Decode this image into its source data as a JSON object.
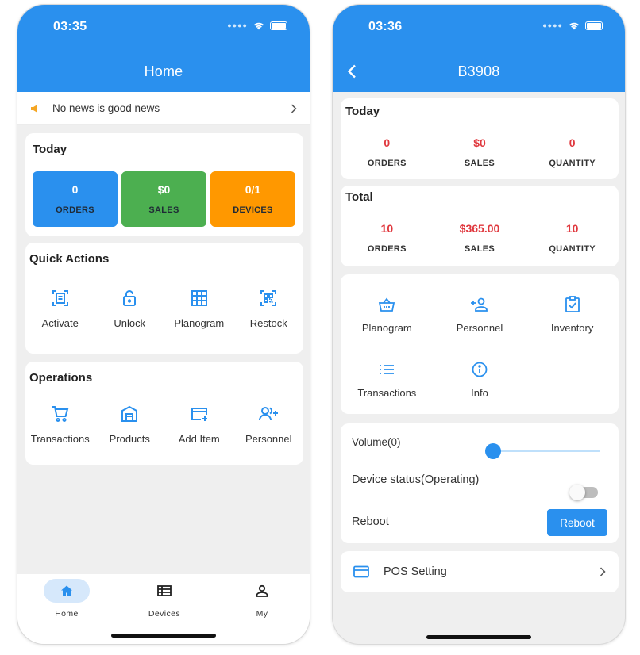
{
  "home": {
    "status_time": "03:35",
    "title": "Home",
    "news": "No news is good news",
    "today": {
      "title": "Today",
      "stats": [
        {
          "value": "0",
          "label": "ORDERS",
          "color": "#2a90ee"
        },
        {
          "value": "$0",
          "label": "SALES",
          "color": "#4caf50"
        },
        {
          "value": "0/1",
          "label": "DEVICES",
          "color": "#ff9800"
        }
      ]
    },
    "quick_actions": {
      "title": "Quick Actions",
      "items": [
        "Activate",
        "Unlock",
        "Planogram",
        "Restock"
      ]
    },
    "operations": {
      "title": "Operations",
      "items": [
        "Transactions",
        "Products",
        "Add Item",
        "Personnel"
      ]
    },
    "tabs": [
      "Home",
      "Devices",
      "My"
    ]
  },
  "device": {
    "status_time": "03:36",
    "title": "B3908",
    "today": {
      "title": "Today",
      "stats": [
        {
          "value": "0",
          "label": "ORDERS"
        },
        {
          "value": "$0",
          "label": "SALES"
        },
        {
          "value": "0",
          "label": "QUANTITY"
        }
      ]
    },
    "total": {
      "title": "Total",
      "stats": [
        {
          "value": "10",
          "label": "ORDERS"
        },
        {
          "value": "$365.00",
          "label": "SALES"
        },
        {
          "value": "10",
          "label": "QUANTITY"
        }
      ]
    },
    "actions_row1": [
      "Planogram",
      "Personnel",
      "Inventory"
    ],
    "actions_row2": [
      "Transactions",
      "Info"
    ],
    "volume_label": "Volume(0)",
    "volume_level": 0,
    "device_status_label": "Device status(Operating)",
    "device_status_on": false,
    "reboot_label": "Reboot",
    "reboot_button": "Reboot",
    "pos_setting": "POS Setting"
  },
  "colors": {
    "accent": "#2a90ee",
    "value_red": "#e0383e"
  }
}
